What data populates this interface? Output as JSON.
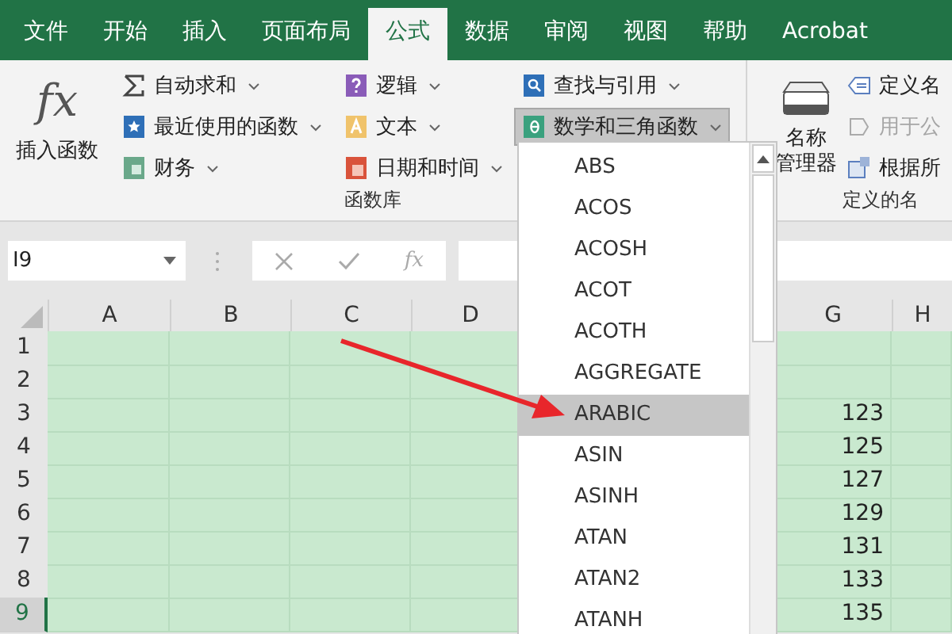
{
  "tabs": [
    {
      "label": "文件",
      "selected": false
    },
    {
      "label": "开始",
      "selected": false
    },
    {
      "label": "插入",
      "selected": false
    },
    {
      "label": "页面布局",
      "selected": false
    },
    {
      "label": "公式",
      "selected": true
    },
    {
      "label": "数据",
      "selected": false
    },
    {
      "label": "审阅",
      "selected": false
    },
    {
      "label": "视图",
      "selected": false
    },
    {
      "label": "帮助",
      "selected": false
    },
    {
      "label": "Acrobat",
      "selected": false
    }
  ],
  "ribbon": {
    "function_library": {
      "insert_function": {
        "icon_text": "fx",
        "label": "插入函数"
      },
      "commands": [
        {
          "label": "自动求和",
          "pressed": false
        },
        {
          "label": "最近使用的函数",
          "pressed": false
        },
        {
          "label": "财务",
          "pressed": false
        },
        {
          "label": "逻辑",
          "pressed": false
        },
        {
          "label": "文本",
          "pressed": false
        },
        {
          "label": "日期和时间",
          "pressed": false
        },
        {
          "label": "查找与引用",
          "pressed": false
        },
        {
          "label": "数学和三角函数",
          "pressed": true
        }
      ],
      "group_label": "函数库"
    },
    "defined_names": {
      "name_manager": {
        "label_lines": [
          "名称",
          "管理器"
        ]
      },
      "commands": [
        {
          "label": "定义名",
          "disabled": false
        },
        {
          "label": "用于公",
          "disabled": true
        },
        {
          "label": "根据所",
          "disabled": false
        }
      ],
      "group_label": "定义的名"
    }
  },
  "formula_bar": {
    "name_box": "I9",
    "fx": "fx"
  },
  "function_menu": {
    "items": [
      {
        "label": "ABS",
        "selected": false
      },
      {
        "label": "ACOS",
        "selected": false
      },
      {
        "label": "ACOSH",
        "selected": false
      },
      {
        "label": "ACOT",
        "selected": false
      },
      {
        "label": "ACOTH",
        "selected": false
      },
      {
        "label": "AGGREGATE",
        "selected": false
      },
      {
        "label": "ARABIC",
        "selected": true
      },
      {
        "label": "ASIN",
        "selected": false
      },
      {
        "label": "ASINH",
        "selected": false
      },
      {
        "label": "ATAN",
        "selected": false
      },
      {
        "label": "ATAN2",
        "selected": false
      },
      {
        "label": "ATANH",
        "selected": false
      }
    ]
  },
  "sheet": {
    "columns": [
      "A",
      "B",
      "C",
      "D",
      "G",
      "H"
    ],
    "rows": [
      {
        "label": "1",
        "selected": false
      },
      {
        "label": "2",
        "selected": false
      },
      {
        "label": "3",
        "selected": false,
        "g": "123"
      },
      {
        "label": "4",
        "selected": false,
        "g": "125"
      },
      {
        "label": "5",
        "selected": false,
        "g": "127"
      },
      {
        "label": "6",
        "selected": false,
        "g": "129"
      },
      {
        "label": "7",
        "selected": false,
        "g": "131"
      },
      {
        "label": "8",
        "selected": false,
        "g": "133"
      },
      {
        "label": "9",
        "selected": true,
        "g": "135"
      }
    ]
  }
}
